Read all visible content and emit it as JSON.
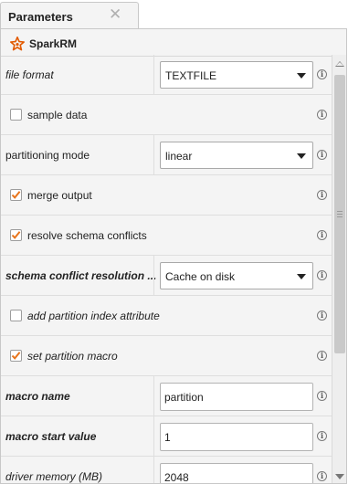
{
  "tab": {
    "title": "Parameters",
    "close_icon": "close-icon"
  },
  "operator": {
    "name": "SparkRM",
    "icon": "spark-star-icon",
    "icon_color": "#e25a00"
  },
  "accent_color": "#e8741b",
  "params": {
    "file_format": {
      "label": "file format",
      "value": "TEXTFILE"
    },
    "sample_data": {
      "label": "sample data",
      "checked": false
    },
    "partitioning_mode": {
      "label": "partitioning mode",
      "value": "linear"
    },
    "merge_output": {
      "label": "merge output",
      "checked": true
    },
    "resolve_schema_conflicts": {
      "label": "resolve schema conflicts",
      "checked": true
    },
    "schema_conflict_resolution": {
      "label": "schema conflict resolution ...",
      "value": "Cache on disk"
    },
    "add_partition_index_attribute": {
      "label": "add partition index attribute",
      "checked": false
    },
    "set_partition_macro": {
      "label": "set partition macro",
      "checked": true
    },
    "macro_name": {
      "label": "macro name",
      "value": "partition"
    },
    "macro_start_value": {
      "label": "macro start value",
      "value": "1"
    },
    "driver_memory": {
      "label": "driver memory (MB)",
      "value": "2048"
    }
  }
}
